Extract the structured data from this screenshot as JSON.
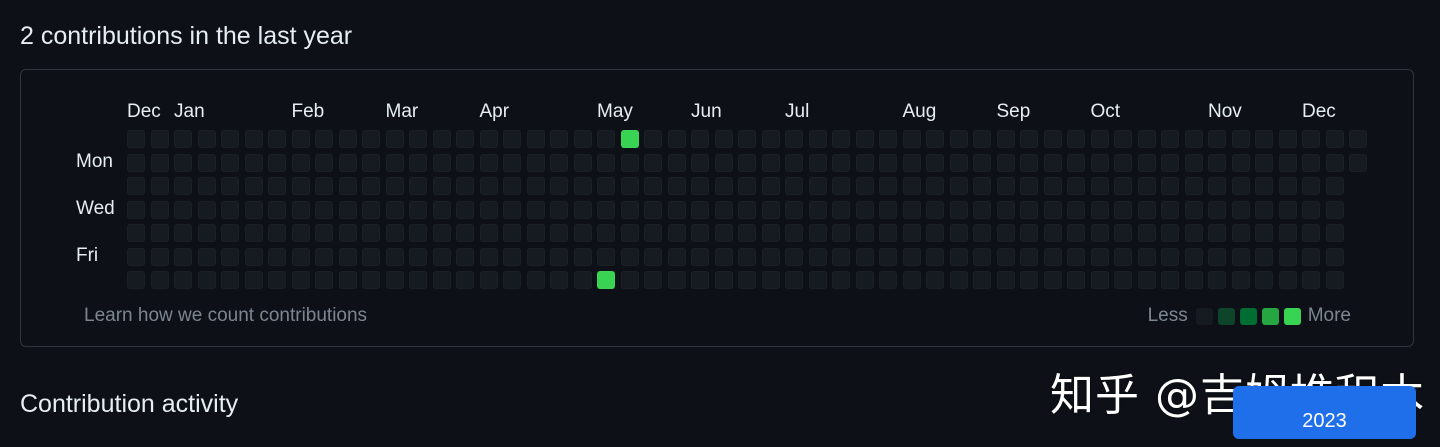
{
  "heading": "2 contributions in the last year",
  "graph": {
    "months": [
      {
        "label": "Dec",
        "week": 0
      },
      {
        "label": "Jan",
        "week": 2
      },
      {
        "label": "Feb",
        "week": 7
      },
      {
        "label": "Mar",
        "week": 11
      },
      {
        "label": "Apr",
        "week": 15
      },
      {
        "label": "May",
        "week": 20
      },
      {
        "label": "Jun",
        "week": 24
      },
      {
        "label": "Jul",
        "week": 28
      },
      {
        "label": "Aug",
        "week": 33
      },
      {
        "label": "Sep",
        "week": 37
      },
      {
        "label": "Oct",
        "week": 41
      },
      {
        "label": "Nov",
        "week": 46
      },
      {
        "label": "Dec",
        "week": 50
      }
    ],
    "days": [
      {
        "label": "Mon",
        "row": 1
      },
      {
        "label": "Wed",
        "row": 3
      },
      {
        "label": "Fri",
        "row": 5
      }
    ],
    "weeks": 53,
    "last_week_days": 2,
    "contributions": [
      {
        "week": 21,
        "day": 0,
        "level": 4
      },
      {
        "week": 20,
        "day": 6,
        "level": 4
      }
    ],
    "level_colors": [
      "#161b22",
      "#0e4429",
      "#006d32",
      "#26a641",
      "#39d353"
    ]
  },
  "footer": {
    "learn_link": "Learn how we count contributions",
    "legend_less": "Less",
    "legend_more": "More"
  },
  "activity_heading": "Contribution activity",
  "year_button": "2023",
  "watermark": "知乎 @吉姆堆积木"
}
